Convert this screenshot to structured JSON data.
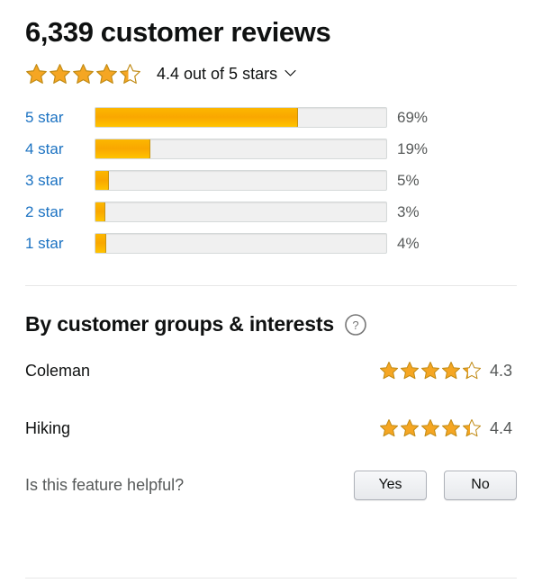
{
  "header": {
    "title": "6,339 customer reviews",
    "overall_stars": 4.4,
    "overall_text": "4.4 out of 5 stars",
    "chevron_icon": "chevron-down-icon"
  },
  "histogram": {
    "rows": [
      {
        "label": "5 star",
        "percent": "69%",
        "value": 69
      },
      {
        "label": "4 star",
        "percent": "19%",
        "value": 19
      },
      {
        "label": "3 star",
        "percent": "5%",
        "value": 5
      },
      {
        "label": "2 star",
        "percent": "3%",
        "value": 3
      },
      {
        "label": "1 star",
        "percent": "4%",
        "value": 4
      }
    ]
  },
  "groups_section": {
    "title": "By customer groups & interests",
    "help_icon": "help-circle-icon",
    "rows": [
      {
        "name": "Coleman",
        "score": "4.3",
        "stars": 4.3
      },
      {
        "name": "Hiking",
        "score": "4.4",
        "stars": 4.4
      }
    ]
  },
  "feedback": {
    "question": "Is this feature helpful?",
    "yes_label": "Yes",
    "no_label": "No"
  },
  "colors": {
    "star_fill": "#f5a623",
    "star_empty": "#ffffff",
    "star_stroke": "#c08a14",
    "bar_fill": "#f9a700",
    "bar_track": "#f0f0f0",
    "link_blue": "#1b72c2",
    "muted_text": "#565959",
    "divider": "#e7e7e7"
  },
  "chart_data": {
    "type": "bar",
    "title": "6,339 customer reviews",
    "categories": [
      "5 star",
      "4 star",
      "3 star",
      "2 star",
      "1 star"
    ],
    "values": [
      69,
      19,
      5,
      3,
      4
    ],
    "xlabel": "",
    "ylabel": "",
    "xlim": [
      0,
      100
    ],
    "unit": "%",
    "orientation": "horizontal",
    "grid": false,
    "legend": false,
    "average_rating": 4.4,
    "rating_scale_max": 5,
    "total_reviews": 6339,
    "secondary_ratings": [
      {
        "name": "Coleman",
        "value": 4.3
      },
      {
        "name": "Hiking",
        "value": 4.4
      }
    ]
  }
}
